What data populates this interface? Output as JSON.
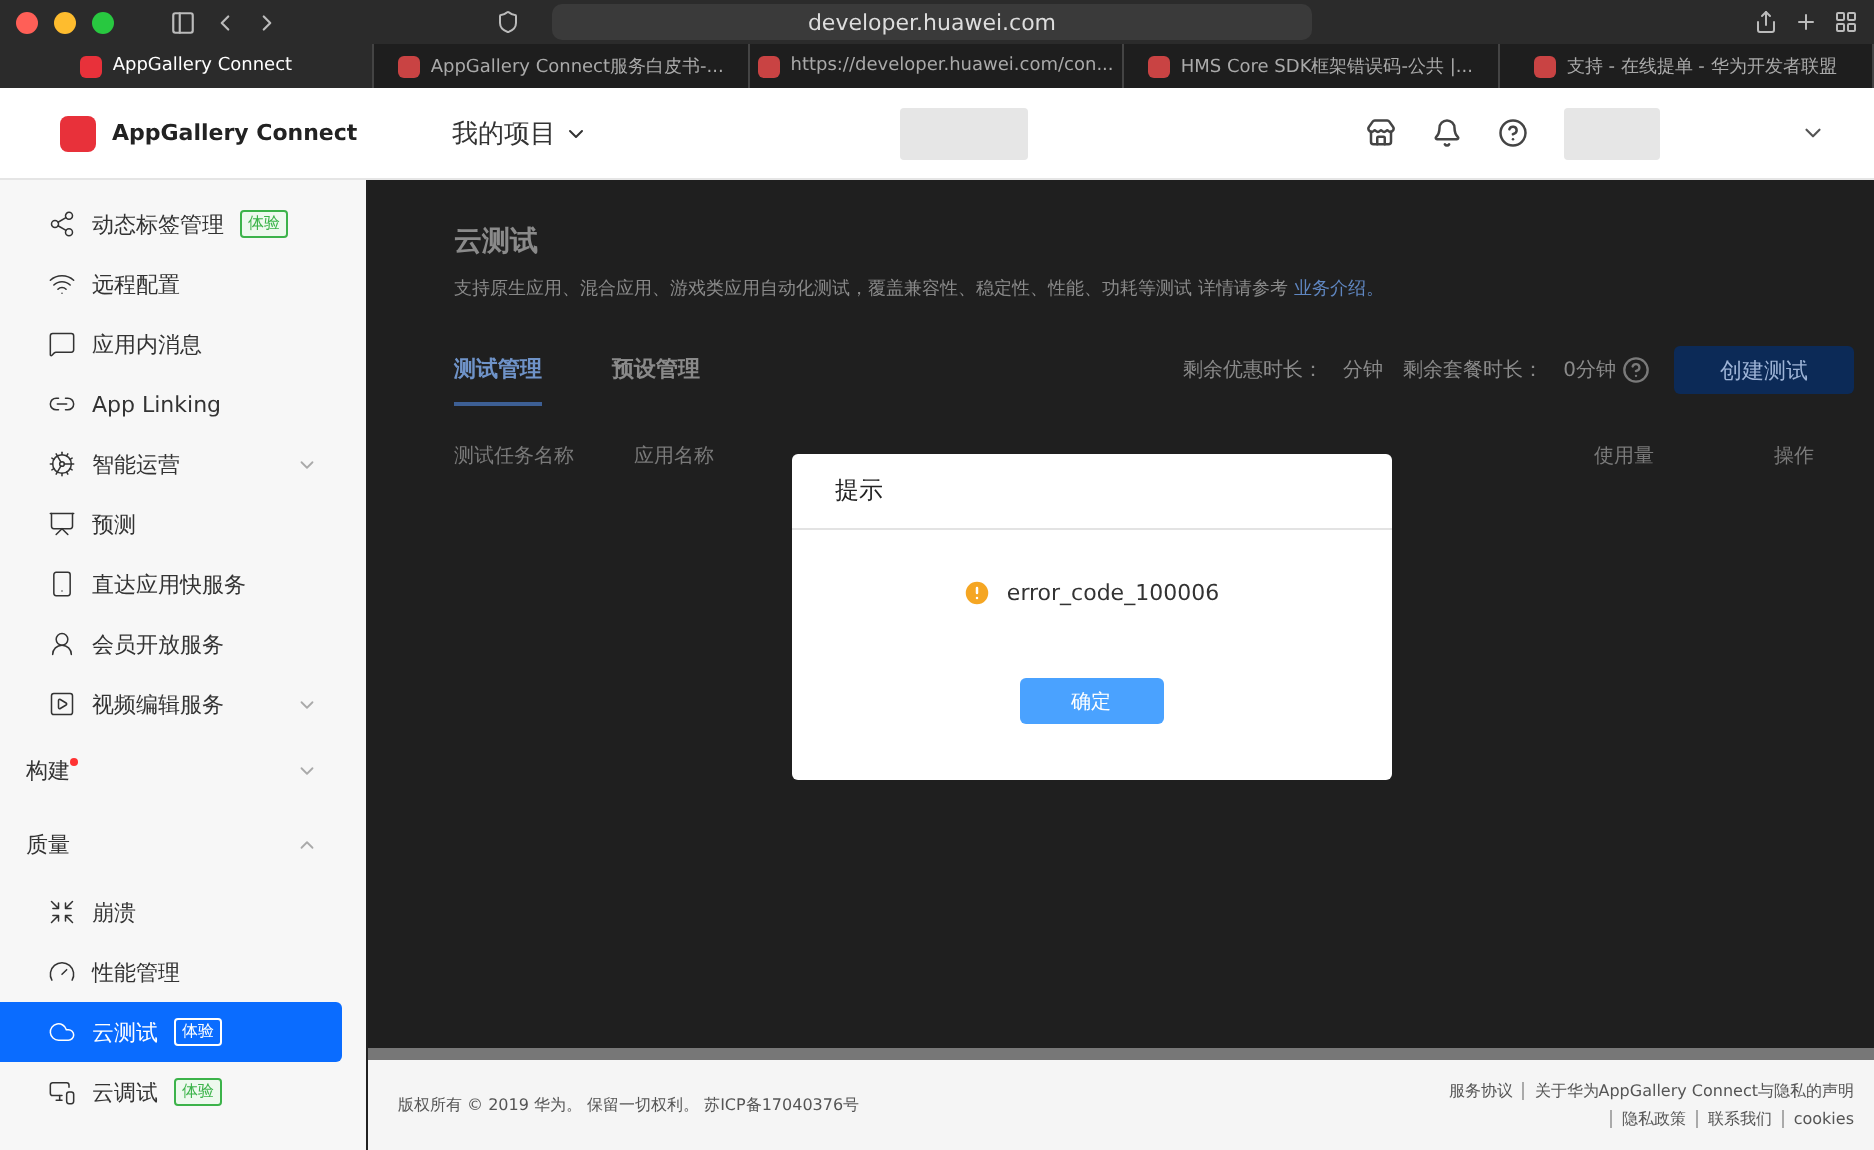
{
  "browser": {
    "address": "developer.huawei.com",
    "tabs": [
      {
        "label": "AppGallery Connect",
        "selected": true
      },
      {
        "label": "AppGallery Connect服务白皮书-...",
        "selected": false
      },
      {
        "label": "https://developer.huawei.com/con...",
        "selected": false
      },
      {
        "label": "HMS Core SDK框架错误码-公共 |...",
        "selected": false
      },
      {
        "label": "支持 - 在线提单 - 华为开发者联盟",
        "selected": false
      }
    ]
  },
  "header": {
    "brand": "AppGallery Connect",
    "project_menu": "我的项目"
  },
  "sidebar": {
    "items": [
      {
        "kind": "item",
        "label": "动态标签管理",
        "badge": "体验",
        "selected": false
      },
      {
        "kind": "item",
        "label": "远程配置",
        "selected": false
      },
      {
        "kind": "item",
        "label": "应用内消息",
        "selected": false
      },
      {
        "kind": "item",
        "label": "App Linking",
        "selected": false
      },
      {
        "kind": "item",
        "label": "智能运营",
        "expandable": true,
        "selected": false
      },
      {
        "kind": "item",
        "label": "预测",
        "selected": false
      },
      {
        "kind": "item",
        "label": "直达应用快服务",
        "selected": false
      },
      {
        "kind": "item",
        "label": "会员开放服务",
        "selected": false
      },
      {
        "kind": "item",
        "label": "视频编辑服务",
        "expandable": true,
        "selected": false
      },
      {
        "kind": "section",
        "label": "构建",
        "dot": true,
        "expanded": false
      },
      {
        "kind": "section",
        "label": "质量",
        "dot": false,
        "expanded": true
      },
      {
        "kind": "item",
        "label": "崩溃",
        "selected": false
      },
      {
        "kind": "item",
        "label": "性能管理",
        "selected": false
      },
      {
        "kind": "item",
        "label": "云测试",
        "badge": "体验",
        "selected": true
      },
      {
        "kind": "item",
        "label": "云调试",
        "badge": "体验",
        "selected": false
      }
    ]
  },
  "page": {
    "title": "云测试",
    "description": "支持原生应用、混合应用、游戏类应用自动化测试，覆盖兼容性、稳定性、性能、功耗等测试   详情请参考",
    "description_link": "业务介绍。",
    "tabs": [
      {
        "label": "测试管理",
        "selected": true
      },
      {
        "label": "预设管理",
        "selected": false
      }
    ],
    "promo_label": "剩余优惠时长：",
    "promo_value": "分钟",
    "package_label": "剩余套餐时长：",
    "package_value": "0分钟",
    "create_button": "创建测试",
    "columns": [
      "测试任务名称",
      "应用名称",
      "使用量",
      "操作"
    ]
  },
  "dialog": {
    "title": "提示",
    "message": "error_code_100006",
    "ok_button": "确定"
  },
  "footer": {
    "copyright": "版权所有 © 2019 华为。 保留一切权利。 苏ICP备17040376号",
    "links": [
      "服务协议",
      "关于华为AppGallery Connect与隐私的声明",
      "隐私政策",
      "联系我们",
      "cookies"
    ]
  }
}
